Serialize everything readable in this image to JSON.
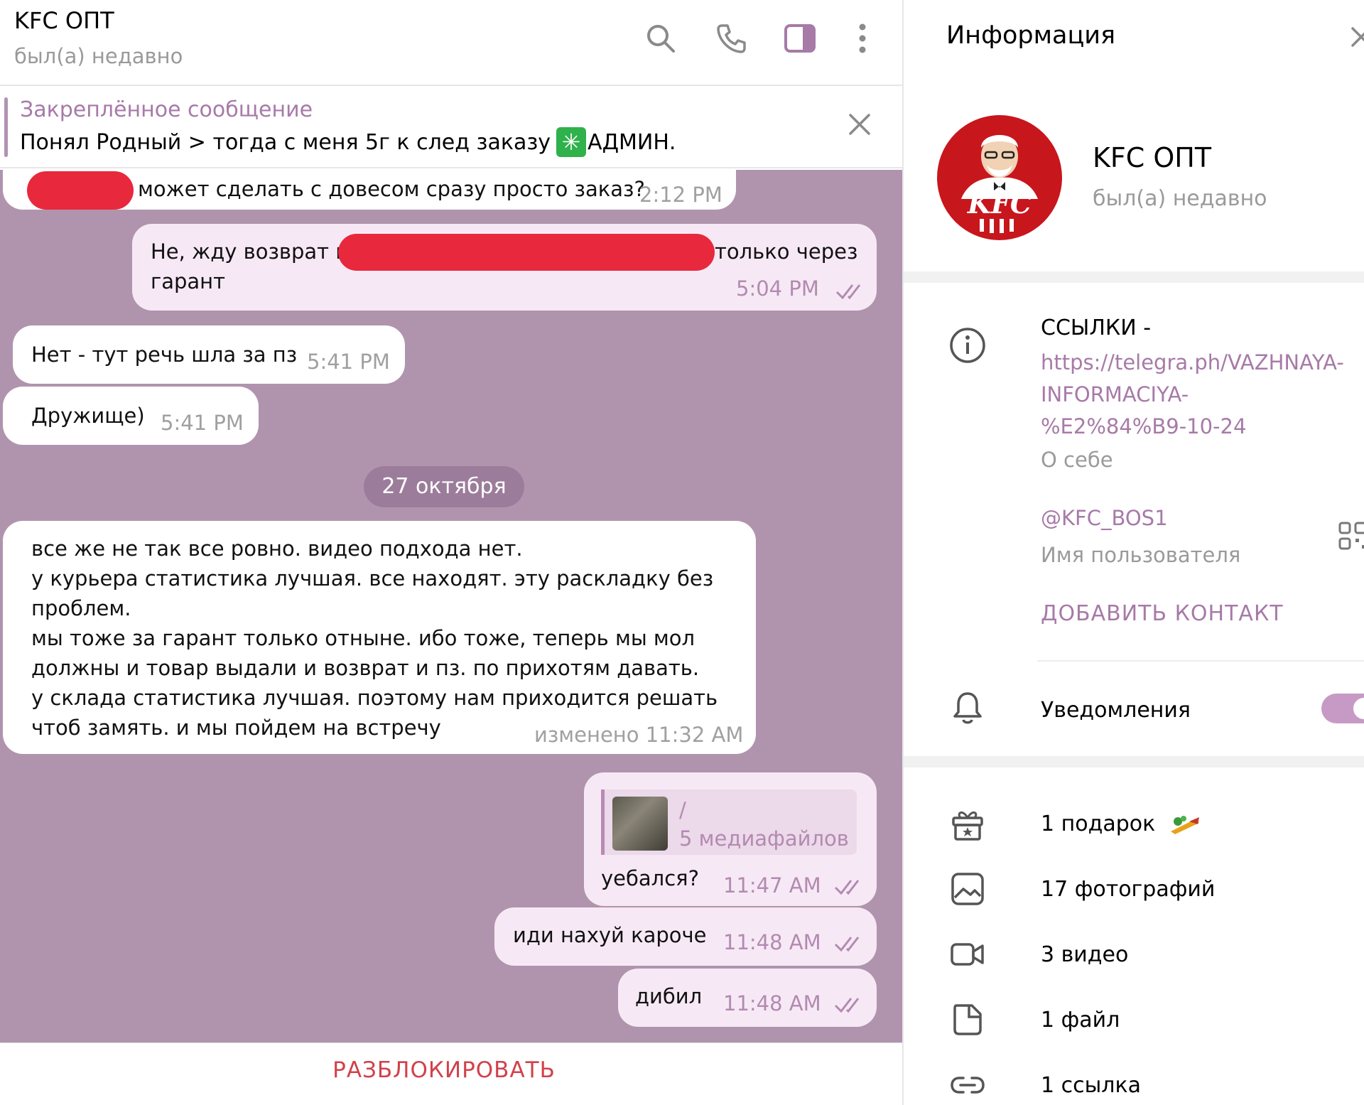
{
  "chat": {
    "title": "KFC ОПТ",
    "status": "был(а) недавно",
    "pinned": {
      "title": "Закреплённое сообщение",
      "text_before": "Понял Родный > тогда с меня 5г к след заказу",
      "emoji": "✳",
      "text_after": "АДМИН."
    },
    "messages": [
      {
        "dir": "in",
        "text": "может сделать с довесом сразу просто заказ?",
        "time": "2:12 PM"
      },
      {
        "dir": "out",
        "line1_a": "Не, жду возврат и",
        "line1_b": "только через",
        "line2": "гарант",
        "time": "5:04 PM"
      },
      {
        "dir": "in",
        "text": "Нет - тут речь шла за пз",
        "time": "5:41 PM"
      },
      {
        "dir": "in",
        "text": "Дружище)",
        "time": "5:41 PM"
      },
      {
        "dir": "in",
        "lines": [
          "все же не так все ровно. видео подхода нет.",
          "у курьера статистика лучшая. все находят. эту раскладку без",
          "проблем.",
          "мы тоже за гарант только отныне. ибо тоже, теперь мы мол",
          "должны и товар выдали и возврат и пз. по прихотям давать.",
          "у склада статистика лучшая. поэтому нам приходится решать",
          "чтоб замять. и мы пойдем на встречу"
        ],
        "time": "изменено 11:32 AM"
      },
      {
        "dir": "out",
        "reply_title": "/",
        "reply_sub": "5 медиафайлов",
        "text": "уебался?",
        "time": "11:47 AM"
      },
      {
        "dir": "out",
        "text": "иди нахуй кароче",
        "time": "11:48 AM"
      },
      {
        "dir": "out",
        "text": "дибил",
        "time": "11:48 AM"
      }
    ],
    "date_separator": "27 октября",
    "unblock_label": "РАЗБЛОКИРОВАТЬ"
  },
  "info": {
    "title": "Информация",
    "name": "KFC ОПТ",
    "status": "был(а) недавно",
    "avatar_text": "KFC",
    "links_label": "ССЫЛКИ -",
    "link_lines": [
      "https://telegra.ph/VAZHNAYA-",
      "INFORMACIYA-",
      "%E2%84%B9-10-24"
    ],
    "about_label": "О себе",
    "username": "@KFC_BOS1",
    "username_label": "Имя пользователя",
    "add_contact": "ДОБАВИТЬ КОНТАКТ",
    "notifications": "Уведомления",
    "notifications_on": true,
    "media": {
      "gifts": "1 подарок",
      "photos": "17 фотографий",
      "videos": "3 видео",
      "files": "1 файл",
      "links": "1 ссылка"
    }
  },
  "colors": {
    "chat_background": "#b094ad",
    "accent": "#a77aa8",
    "outgoing_bubble": "#f6e9f5",
    "unblock": "#d2414b",
    "redaction": "#e8283c"
  }
}
